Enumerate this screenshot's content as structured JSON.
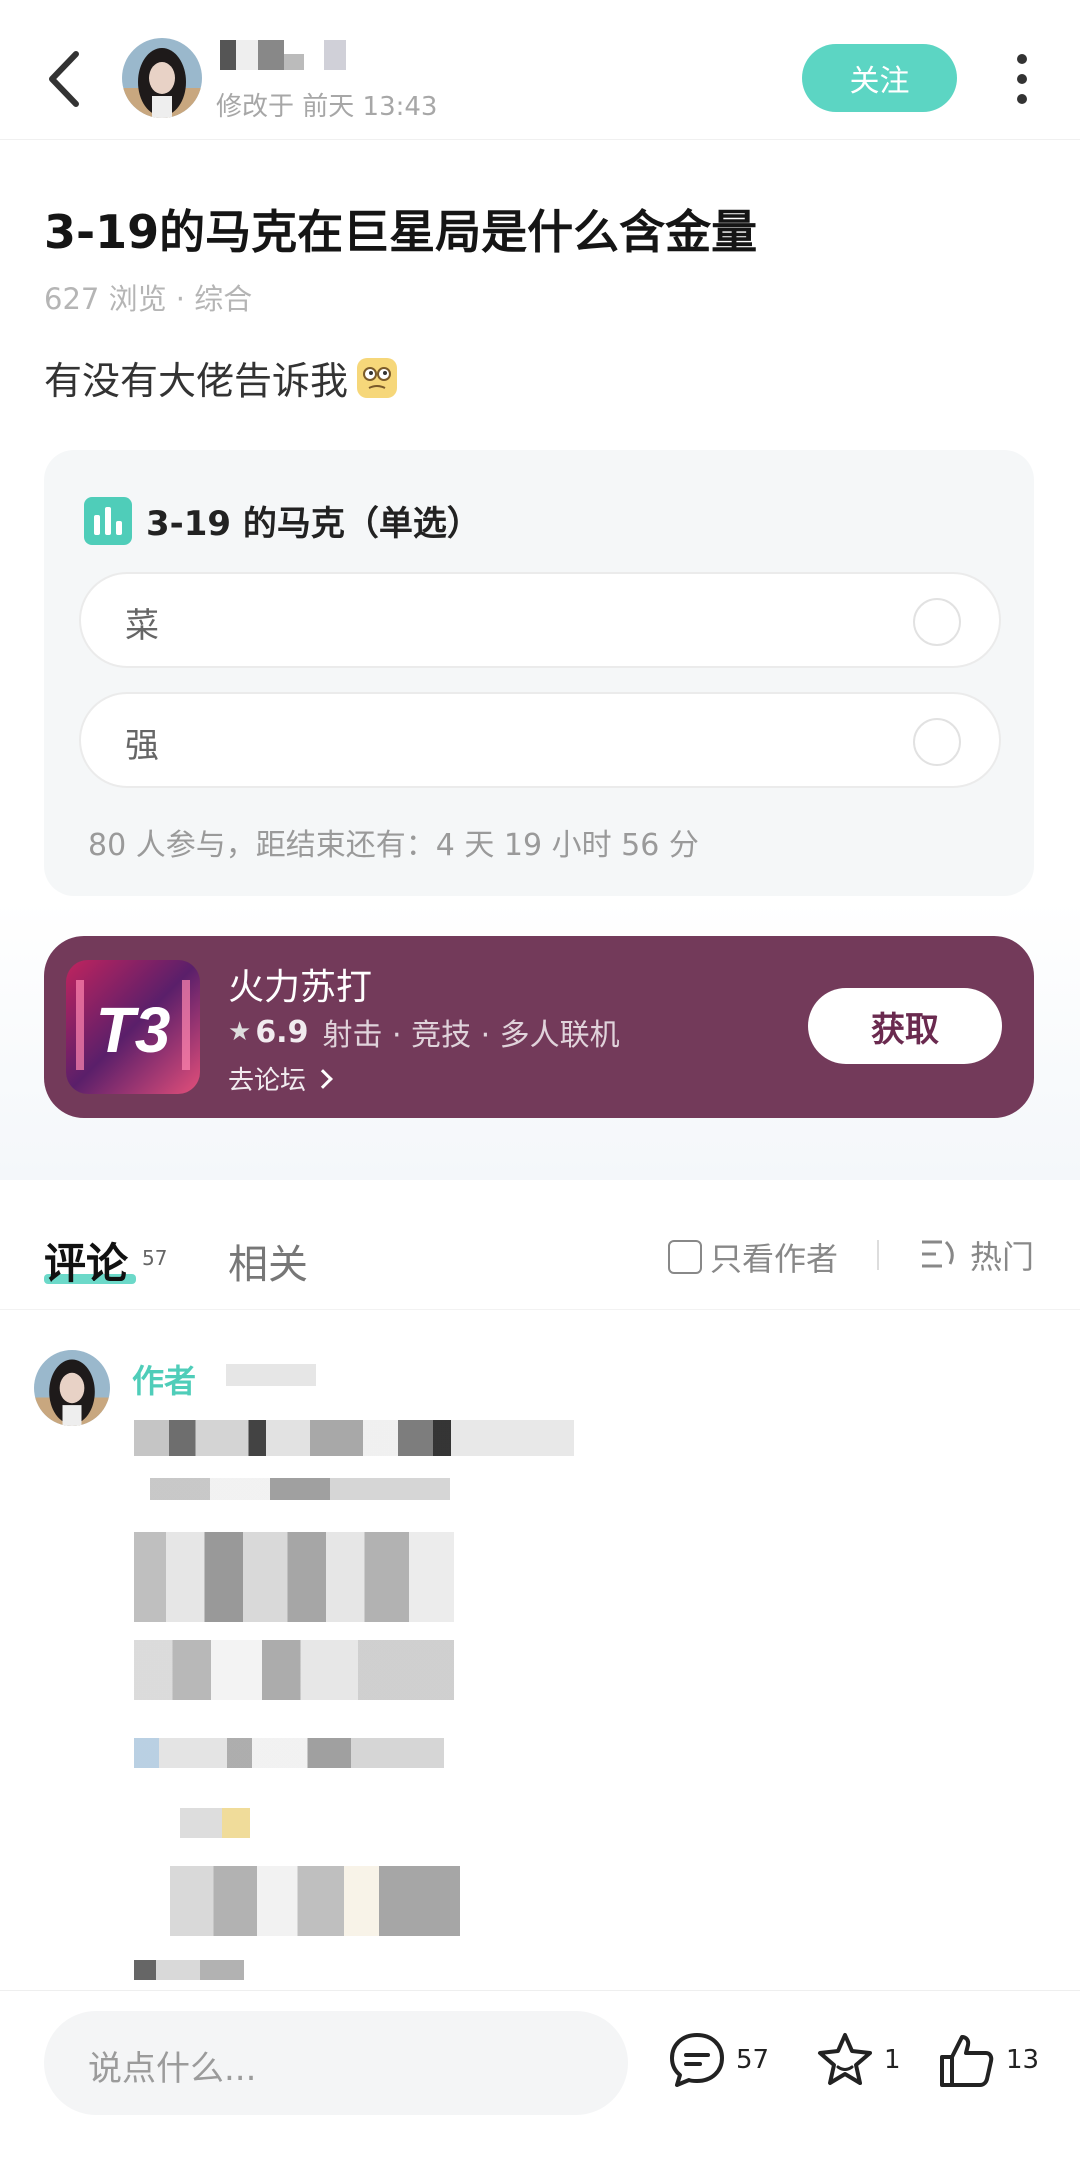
{
  "header": {
    "edit_time": "修改于 前天 13:43",
    "follow_label": "关注"
  },
  "post": {
    "title": "3-19的马克在巨星局是什么含金量",
    "meta": "627 浏览 · 综合",
    "body": "有没有大佬告诉我",
    "emoji_icon": "thinking-face-icon"
  },
  "poll": {
    "title": "3-19 的马克（单选）",
    "options": [
      {
        "label": "菜"
      },
      {
        "label": "强"
      }
    ],
    "footer": "80 人参与，距结束还有：4 天 19 小时 56 分"
  },
  "game_card": {
    "name": "火力苏打",
    "icon_text": "T3",
    "rating": "6.9",
    "tags": "射击 · 竞技 · 多人联机",
    "forum_link": "去论坛",
    "get_label": "获取",
    "bg_color": "#733a5a"
  },
  "tabs": {
    "comment_label": "评论",
    "comment_count": "57",
    "related_label": "相关",
    "author_only_label": "只看作者",
    "sort_label": "热门"
  },
  "comment": {
    "author_tag": "作者"
  },
  "bottom_bar": {
    "input_placeholder": "说点什么...",
    "comment_count": "57",
    "favorite_count": "1",
    "like_count": "13"
  },
  "colors": {
    "accent": "#5cd5c3",
    "author_accent": "#4fcdb9"
  }
}
